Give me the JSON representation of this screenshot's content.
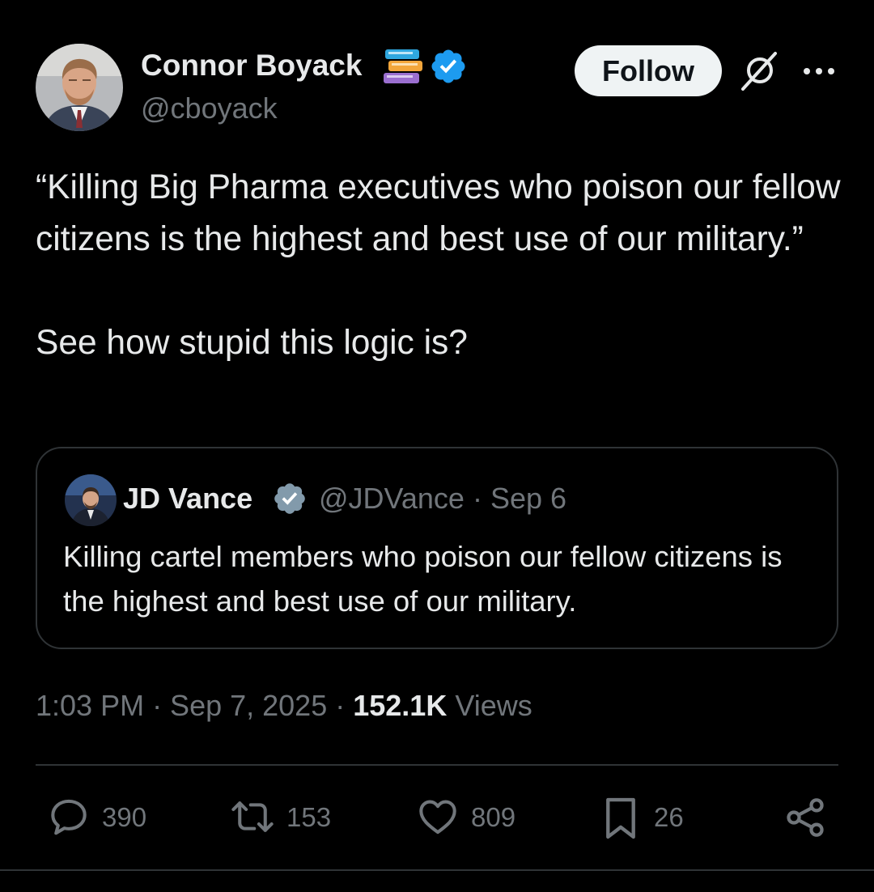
{
  "author": {
    "name": "Connor Boyack",
    "handle": "@cboyack",
    "avatar_icon": "avatar-photo",
    "badges": [
      "books-emoji",
      "blue-verified-icon"
    ]
  },
  "header": {
    "follow_label": "Follow",
    "grok_icon": "grok-icon",
    "more_icon": "more-icon"
  },
  "tweet": {
    "text_line1": "“Killing Big Pharma executives who poison our fellow citizens is the highest and best use of our military.”",
    "text_line2": "See how stupid this logic is?"
  },
  "quote": {
    "author_name": "JD Vance",
    "author_meta": "@JDVance · Sep 6",
    "verified_icon": "gray-verified-icon",
    "text": "Killing cartel members who poison our fellow citizens is the highest and best use of our military."
  },
  "meta": {
    "time_date": "1:03 PM · Sep 7, 2025 · ",
    "views_count": "152.1K",
    "views_label": " Views"
  },
  "actions": {
    "replies": "390",
    "reposts": "153",
    "likes": "809",
    "bookmarks": "26"
  },
  "colors": {
    "background": "#000000",
    "primary_text": "#e7e9ea",
    "secondary_text": "#71767b",
    "border": "#2f3336",
    "verified_blue": "#1d9bf0",
    "follow_bg": "#eff3f4"
  }
}
